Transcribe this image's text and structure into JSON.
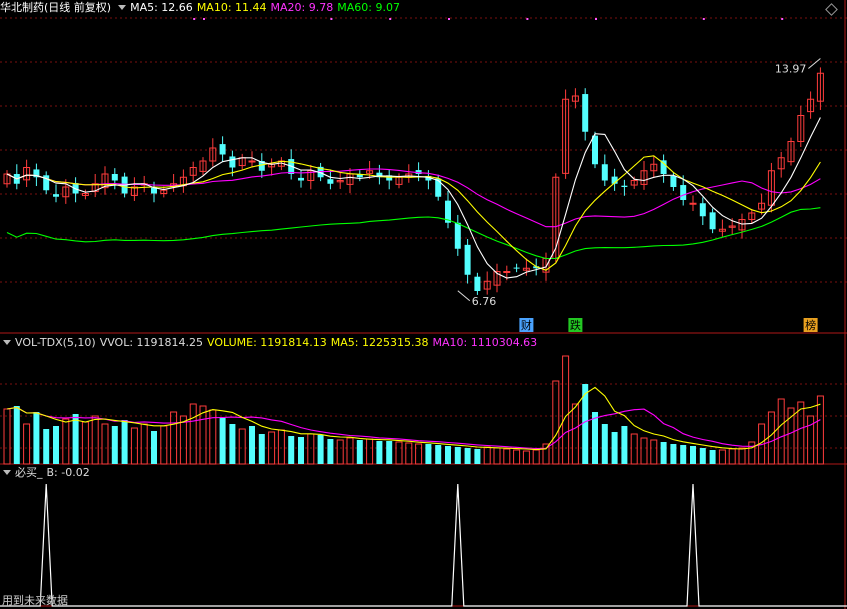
{
  "panel1": {
    "stock_name": "华北制药",
    "mode": "(日线 前复权)",
    "ma5": "MA5: 12.66",
    "ma10": "MA10: 11.44",
    "ma20": "MA20: 9.78",
    "ma60": "MA60: 9.07",
    "high_label": "13.97",
    "low_label": "6.76",
    "tag_finance": "财",
    "tag_drop": "跌",
    "tag_rank": "榜"
  },
  "panel2": {
    "indicator": "VOL-TDX(5,10)",
    "vvol": "VVOL: 1191814.25",
    "volume": "VOLUME: 1191814.13",
    "ma5": "MA5: 1225315.38",
    "ma10": "MA10: 1110304.63"
  },
  "panel3": {
    "indicator": "必买_",
    "b_value": "B: -0.02",
    "footer": "用到未来数据"
  },
  "colors": {
    "up": "#ff3c3c",
    "down": "#54ffff",
    "ma5": "#ffffff",
    "ma10": "#ffff00",
    "ma20": "#ff00ff",
    "ma60": "#00ff00",
    "grid": "#7a1010"
  },
  "chart_data": [
    {
      "type": "candlestick",
      "title": "华北制药 日线 前复权",
      "n_bars": 84,
      "close": [
        10.6,
        10.3,
        10.8,
        10.5,
        10.1,
        9.9,
        10.2,
        10.0,
        10.0,
        10.3,
        10.6,
        10.4,
        10.0,
        10.2,
        10.3,
        10.0,
        10.1,
        10.3,
        10.5,
        10.8,
        11.0,
        11.4,
        11.2,
        10.8,
        11.1,
        11.0,
        10.7,
        10.9,
        11.0,
        10.6,
        10.4,
        10.7,
        10.5,
        10.3,
        10.4,
        10.6,
        10.5,
        10.7,
        10.5,
        10.4,
        10.5,
        10.6,
        10.6,
        10.4,
        9.9,
        9.1,
        8.3,
        7.5,
        7.0,
        7.3,
        7.6,
        7.6,
        7.7,
        7.7,
        7.7,
        8.0,
        10.5,
        12.9,
        13.0,
        11.9,
        10.9,
        10.4,
        10.3,
        10.2,
        10.4,
        10.7,
        10.9,
        10.6,
        10.2,
        9.8,
        9.7,
        9.3,
        8.9,
        8.9,
        9.0,
        9.2,
        9.4,
        9.7,
        10.7,
        11.1,
        11.6,
        12.4,
        12.9,
        13.7
      ],
      "volume_relative": [
        55,
        58,
        40,
        52,
        35,
        38,
        45,
        50,
        42,
        48,
        40,
        38,
        44,
        36,
        40,
        33,
        38,
        52,
        48,
        60,
        58,
        54,
        46,
        40,
        35,
        38,
        30,
        32,
        34,
        28,
        27,
        30,
        29,
        25,
        24,
        26,
        24,
        25,
        23,
        23,
        22,
        21,
        20,
        20,
        19,
        18,
        17,
        16,
        15,
        17,
        16,
        15,
        14,
        13,
        14,
        20,
        83,
        108,
        60,
        80,
        52,
        40,
        32,
        38,
        30,
        26,
        24,
        22,
        20,
        19,
        18,
        16,
        14,
        14,
        15,
        16,
        22,
        40,
        52,
        65,
        56,
        62,
        48,
        68
      ],
      "annotations": [
        "13.97",
        "6.76",
        "财",
        "跌",
        "榜"
      ]
    },
    {
      "type": "bar",
      "title": "VOL-TDX(5,10)",
      "series": [
        {
          "name": "VOLUME",
          "last": 1191814.13
        },
        {
          "name": "MA5",
          "last": 1225315.38
        },
        {
          "name": "MA10",
          "last": 1110304.63
        }
      ]
    },
    {
      "type": "line",
      "title": "必买_",
      "series": [
        {
          "name": "B",
          "last": -0.02,
          "spikes_at_bar": [
            4,
            46,
            70
          ]
        }
      ]
    }
  ]
}
